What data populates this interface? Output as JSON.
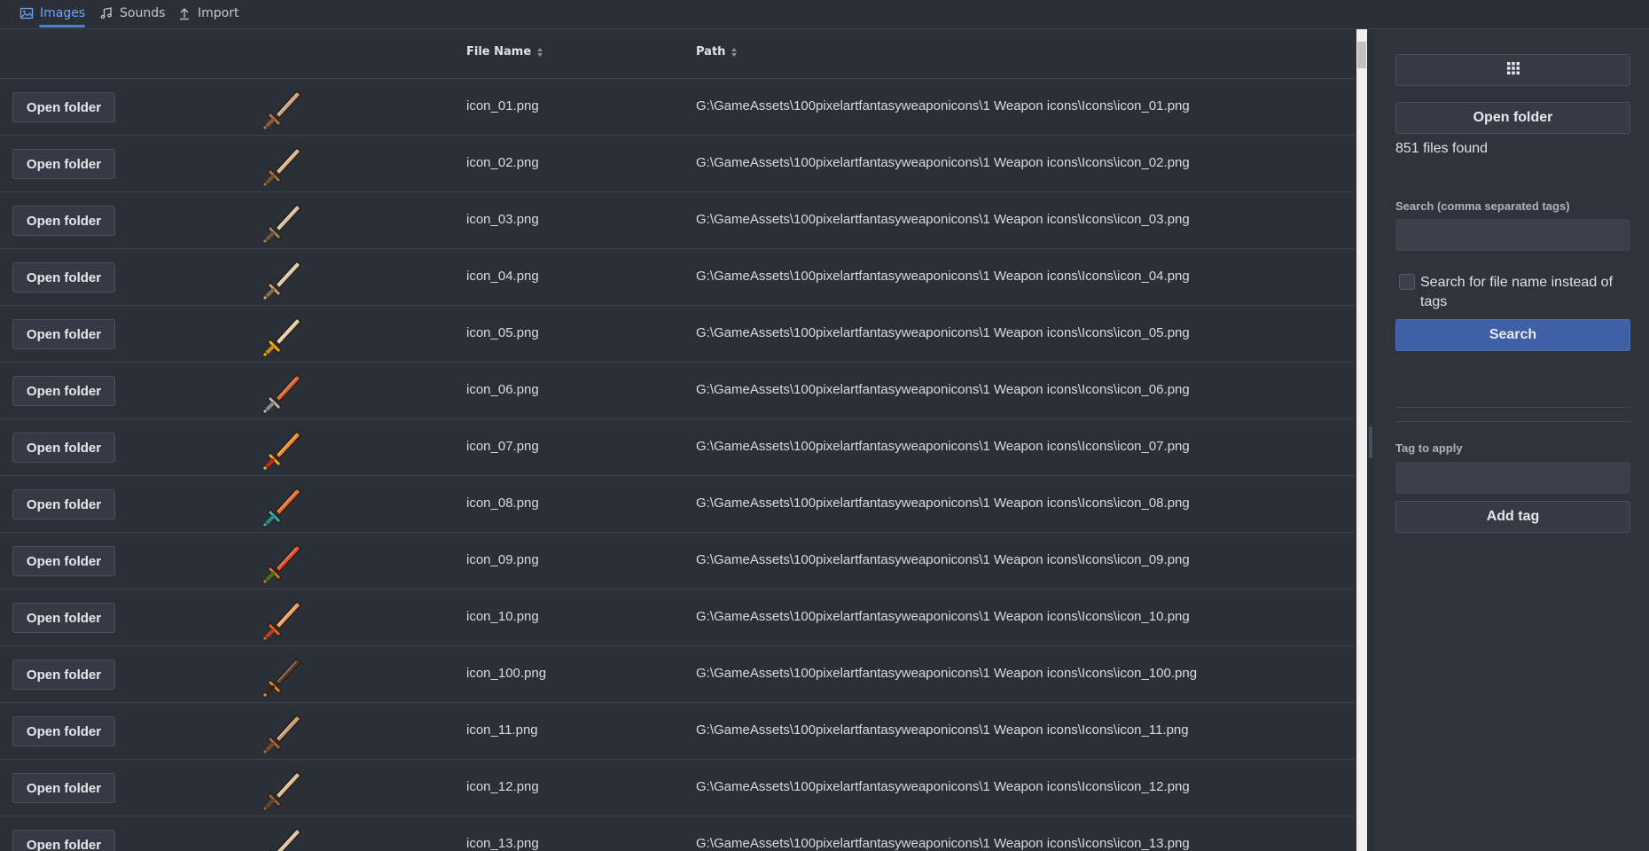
{
  "tabs": [
    {
      "label": "Images",
      "icon": "image-icon",
      "active": true
    },
    {
      "label": "Sounds",
      "icon": "music-icon",
      "active": false
    },
    {
      "label": "Import",
      "icon": "upload-icon",
      "active": false
    }
  ],
  "table": {
    "columns": [
      "File Name",
      "Path"
    ],
    "row_button_label": "Open folder",
    "rows": [
      {
        "file": "icon_01.png",
        "path": "G:\\GameAssets\\100pixelartfantasyweaponicons\\1 Weapon icons\\Icons\\icon_01.png",
        "blade": "#c9a47a",
        "hilt": "#8a5a3a",
        "guard": "#b07848"
      },
      {
        "file": "icon_02.png",
        "path": "G:\\GameAssets\\100pixelartfantasyweaponicons\\1 Weapon icons\\Icons\\icon_02.png",
        "blade": "#d7b48a",
        "hilt": "#7a5030",
        "guard": "#a0734c"
      },
      {
        "file": "icon_03.png",
        "path": "G:\\GameAssets\\100pixelartfantasyweaponicons\\1 Weapon icons\\Icons\\icon_03.png",
        "blade": "#d2c2a6",
        "hilt": "#6e5a40",
        "guard": "#9c8464"
      },
      {
        "file": "icon_04.png",
        "path": "G:\\GameAssets\\100pixelartfantasyweaponicons\\1 Weapon icons\\Icons\\icon_04.png",
        "blade": "#dccab0",
        "hilt": "#8c6a48",
        "guard": "#caa676"
      },
      {
        "file": "icon_05.png",
        "path": "G:\\GameAssets\\100pixelartfantasyweaponicons\\1 Weapon icons\\Icons\\icon_05.png",
        "blade": "#e0cfa8",
        "hilt": "#d08a20",
        "guard": "#f0b020"
      },
      {
        "file": "icon_06.png",
        "path": "G:\\GameAssets\\100pixelartfantasyweaponicons\\1 Weapon icons\\Icons\\icon_06.png",
        "blade": "#e0602a",
        "hilt": "#8c8c8c",
        "guard": "#b8b8b8"
      },
      {
        "file": "icon_07.png",
        "path": "G:\\GameAssets\\100pixelartfantasyweaponicons\\1 Weapon icons\\Icons\\icon_07.png",
        "blade": "#f08a2a",
        "hilt": "#c82a18",
        "guard": "#f0b030"
      },
      {
        "file": "icon_08.png",
        "path": "G:\\GameAssets\\100pixelartfantasyweaponicons\\1 Weapon icons\\Icons\\icon_08.png",
        "blade": "#f06a2a",
        "hilt": "#2a8a8a",
        "guard": "#3aaeae"
      },
      {
        "file": "icon_09.png",
        "path": "G:\\GameAssets\\100pixelartfantasyweaponicons\\1 Weapon icons\\Icons\\icon_09.png",
        "blade": "#e84a2a",
        "hilt": "#4a6a2a",
        "guard": "#c87828"
      },
      {
        "file": "icon_10.png",
        "path": "G:\\GameAssets\\100pixelartfantasyweaponicons\\1 Weapon icons\\Icons\\icon_10.png",
        "blade": "#f0a060",
        "hilt": "#c0401a",
        "guard": "#e06828"
      },
      {
        "file": "icon_100.png",
        "path": "G:\\GameAssets\\100pixelartfantasyweaponicons\\1 Weapon icons\\Icons\\icon_100.png",
        "blade": "#5a3a2a",
        "hilt": "#3a2418",
        "guard": "#e08a30"
      },
      {
        "file": "icon_11.png",
        "path": "G:\\GameAssets\\100pixelartfantasyweaponicons\\1 Weapon icons\\Icons\\icon_11.png",
        "blade": "#c89a70",
        "hilt": "#7a4a2a",
        "guard": "#a86a40"
      },
      {
        "file": "icon_12.png",
        "path": "G:\\GameAssets\\100pixelartfantasyweaponicons\\1 Weapon icons\\Icons\\icon_12.png",
        "blade": "#dcbc96",
        "hilt": "#6a4628",
        "guard": "#946640"
      },
      {
        "file": "icon_13.png",
        "path": "G:\\GameAssets\\100pixelartfantasyweaponicons\\1 Weapon icons\\Icons\\icon_13.png",
        "blade": "#d8c6a4",
        "hilt": "#6e5638",
        "guard": "#a08660"
      }
    ]
  },
  "sidebar": {
    "grid_button_icon": "grid-icon",
    "open_folder_label": "Open folder",
    "files_found": "851 files found",
    "search_label": "Search (comma separated tags)",
    "search_value": "",
    "checkbox_label": "Search for file name instead of tags",
    "checkbox_checked": false,
    "search_button": "Search",
    "tag_label": "Tag to apply",
    "tag_value": "",
    "add_tag_button": "Add tag"
  },
  "colors": {
    "accent": "#4a80d9",
    "primary_button": "#3f5fa6",
    "background": "#2b3038"
  }
}
